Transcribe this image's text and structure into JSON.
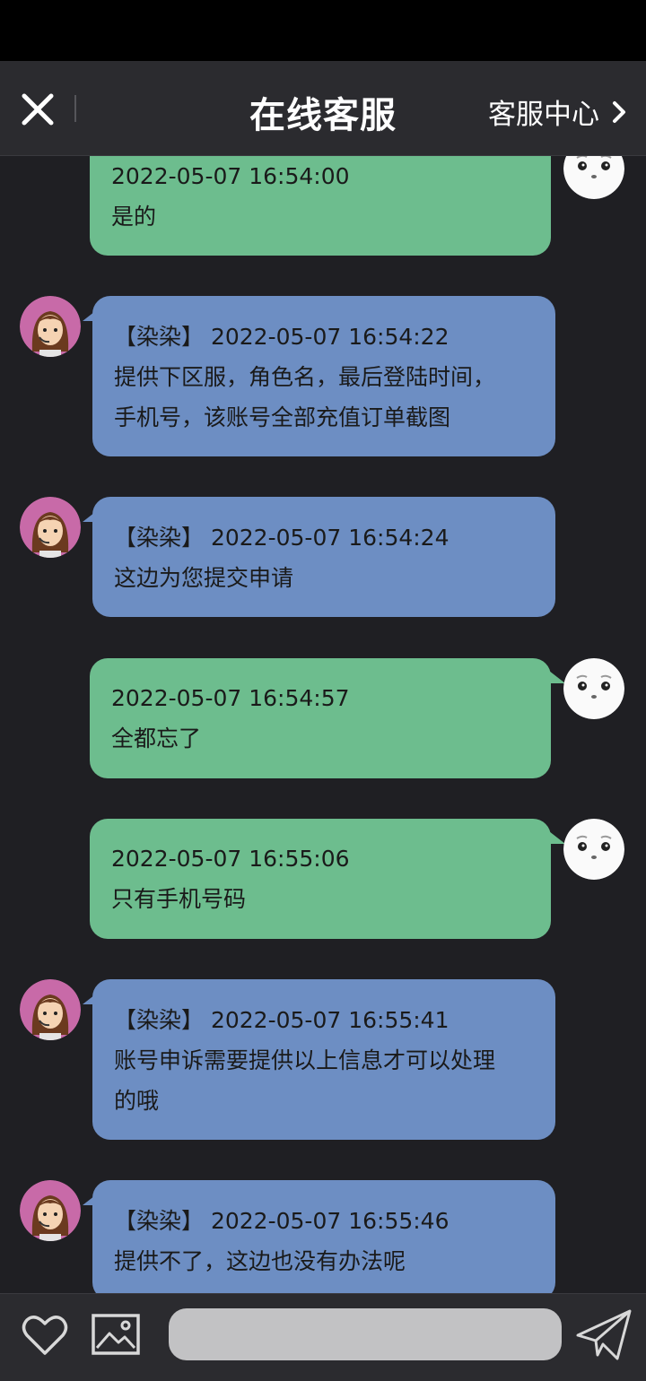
{
  "header": {
    "title": "在线客服",
    "link_label": "客服中心"
  },
  "colors": {
    "user_bubble": "#6dbd8e",
    "agent_bubble": "#6d8ec3",
    "background": "#1f1f23",
    "header": "#2b2b2f"
  },
  "messages": [
    {
      "side": "user",
      "time": "2022-05-07 16:54:00",
      "text": "是的"
    },
    {
      "side": "agent",
      "sender": "【染染】",
      "time": "2022-05-07 16:54:22",
      "text": "提供下区服，角色名，最后登陆时间，\n手机号，该账号全部充值订单截图"
    },
    {
      "side": "agent",
      "sender": "【染染】",
      "time": "2022-05-07 16:54:24",
      "text": "这边为您提交申请"
    },
    {
      "side": "user",
      "time": "2022-05-07 16:54:57",
      "text": "全都忘了"
    },
    {
      "side": "user",
      "time": "2022-05-07 16:55:06",
      "text": "只有手机号码"
    },
    {
      "side": "agent",
      "sender": "【染染】",
      "time": "2022-05-07 16:55:41",
      "text": "账号申诉需要提供以上信息才可以处理\n的哦"
    },
    {
      "side": "agent",
      "sender": "【染染】",
      "time": "2022-05-07 16:55:46",
      "text": "提供不了，这边也没有办法呢"
    }
  ],
  "footer": {
    "input_value": "",
    "icons": [
      "heart-icon",
      "image-icon",
      "send-icon"
    ]
  }
}
